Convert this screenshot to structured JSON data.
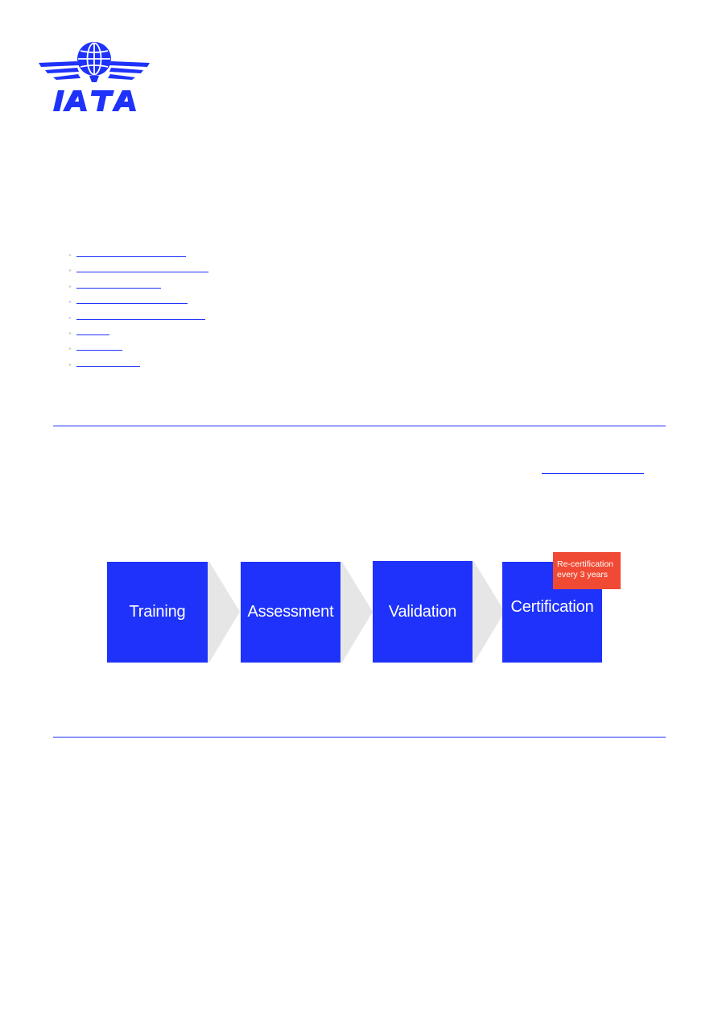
{
  "brand": {
    "name": "IATA",
    "color": "#1e32fa"
  },
  "toc_links": [
    {
      "label": "",
      "color": "#1e32fa"
    },
    {
      "label": "",
      "color": "#1e32fa"
    },
    {
      "label": "",
      "color": "#1e32fa"
    },
    {
      "label": "",
      "color": "#1e32fa"
    },
    {
      "label": "",
      "color": "#1e32fa"
    },
    {
      "label": "",
      "color": "#1e32fa"
    },
    {
      "label": "",
      "color": "#1e32fa"
    },
    {
      "label": "",
      "color": "#1e32fa"
    }
  ],
  "process": {
    "steps": [
      {
        "label": "Training"
      },
      {
        "label": "Assessment"
      },
      {
        "label": "Validation"
      },
      {
        "label": "Certification"
      }
    ],
    "badge": {
      "line1": "Re-certification",
      "line2": "every 3 years",
      "color": "#f04a34"
    },
    "step_color": "#1e32fa",
    "arrow_color": "#e6e6e6"
  }
}
